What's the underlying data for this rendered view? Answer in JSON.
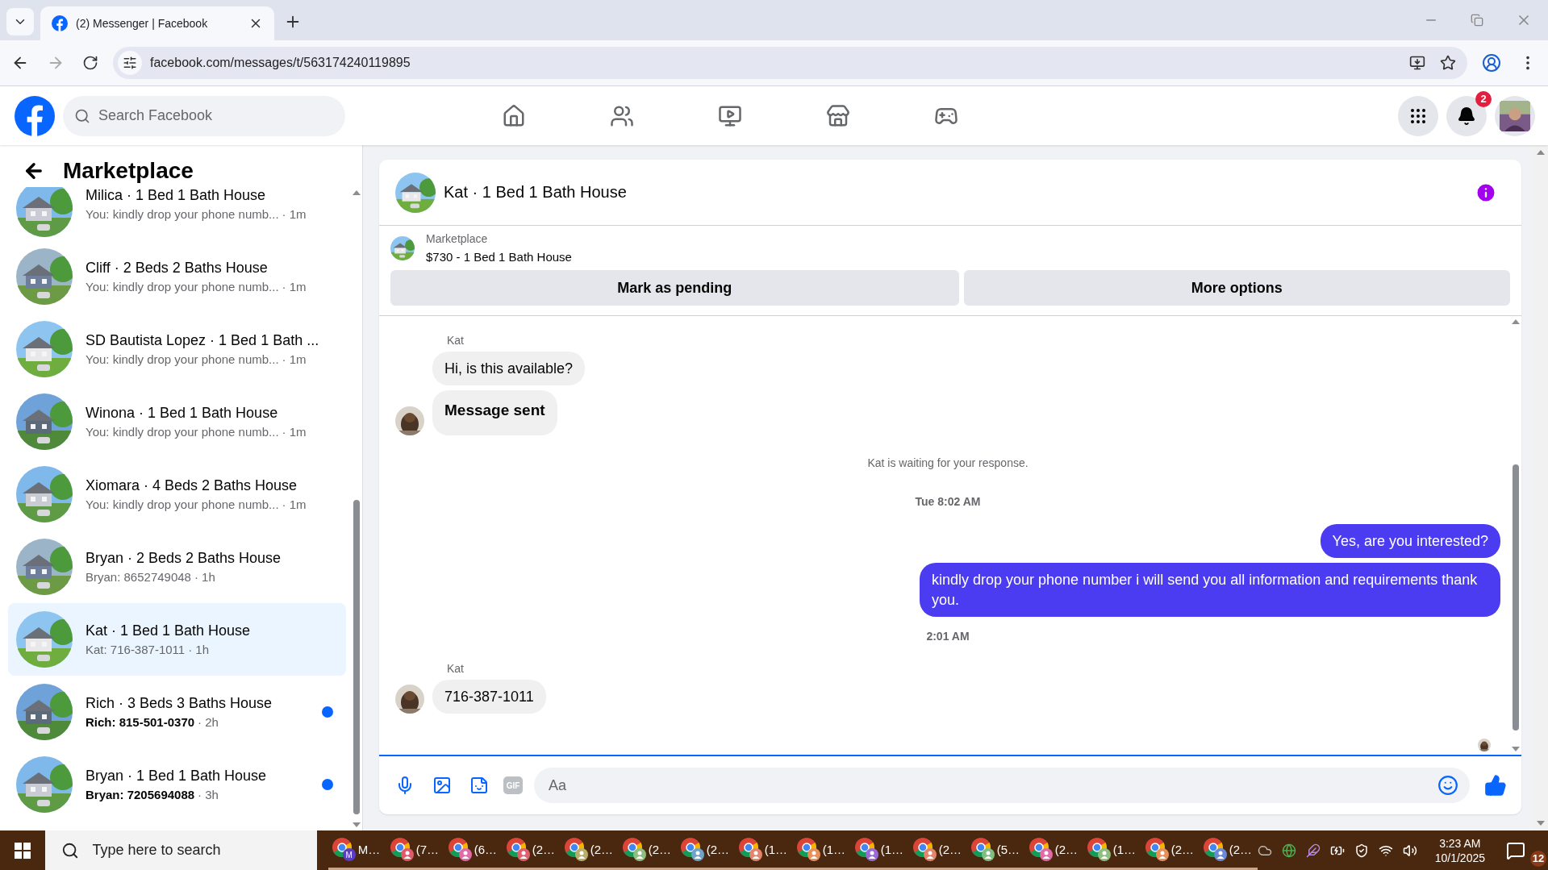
{
  "browser": {
    "tab_title": "(2) Messenger | Facebook",
    "address": "facebook.com/messages/t/563174240119895"
  },
  "header": {
    "search_placeholder": "Search Facebook",
    "notification_count": "2"
  },
  "sidebar": {
    "title": "Marketplace",
    "conversations": [
      {
        "title": "Milica · 1 Bed 1 Bath House",
        "preview": "You: kindly drop your phone numb...",
        "time": "· 1m",
        "selected": false,
        "unread": false
      },
      {
        "title": "Cliff · 2 Beds 2 Baths House",
        "preview": "You: kindly drop your phone numb...",
        "time": "· 1m",
        "selected": false,
        "unread": false
      },
      {
        "title": "SD Bautista Lopez · 1 Bed 1 Bath ...",
        "preview": "You: kindly drop your phone numb...",
        "time": "· 1m",
        "selected": false,
        "unread": false
      },
      {
        "title": "Winona · 1 Bed 1 Bath House",
        "preview": "You: kindly drop your phone numb...",
        "time": "· 1m",
        "selected": false,
        "unread": false
      },
      {
        "title": "Xiomara · 4 Beds 2 Baths House",
        "preview": "You: kindly drop your phone numb...",
        "time": "· 1m",
        "selected": false,
        "unread": false
      },
      {
        "title": "Bryan · 2 Beds 2 Baths House",
        "preview": "Bryan: 8652749048",
        "time": "· 1h",
        "selected": false,
        "unread": false
      },
      {
        "title": "Kat · 1 Bed 1 Bath House",
        "preview": "Kat: 716-387-1011",
        "time": "· 1h",
        "selected": true,
        "unread": false
      },
      {
        "title": "Rich · 3 Beds 3 Baths House",
        "preview": "Rich: 815-501-0370",
        "time": "· 2h",
        "selected": false,
        "unread": true
      },
      {
        "title": "Bryan · 1 Bed 1 Bath House",
        "preview": "Bryan: 7205694088",
        "time": "· 3h",
        "selected": false,
        "unread": true
      }
    ]
  },
  "thread": {
    "title": "Kat · 1 Bed 1 Bath House",
    "listing_label": "Marketplace",
    "listing_detail": "$730 - 1 Bed 1 Bath House",
    "actions": [
      "Mark as pending",
      "More options"
    ],
    "messages": [
      {
        "kind": "sender",
        "text": "Kat"
      },
      {
        "kind": "in",
        "text": "Hi, is this available?",
        "avatar": false,
        "emphasis": false
      },
      {
        "kind": "in",
        "text": "Message sent",
        "avatar": true,
        "emphasis": true
      },
      {
        "kind": "notice",
        "text": "Kat is waiting for your response."
      },
      {
        "kind": "time",
        "text": "Tue 8:02 AM"
      },
      {
        "kind": "out",
        "text": "Yes, are you interested?"
      },
      {
        "kind": "out",
        "text": "kindly drop your phone number i will send you all information and requirements thank you."
      },
      {
        "kind": "time",
        "text": "2:01 AM"
      },
      {
        "kind": "sender",
        "text": "Kat"
      },
      {
        "kind": "in",
        "text": "716-387-1011",
        "avatar": true,
        "emphasis": false
      }
    ],
    "composer": {
      "gif": "GIF",
      "placeholder": "Aa"
    }
  },
  "taskbar": {
    "search_placeholder": "Type here to search",
    "apps": [
      {
        "label": "M…",
        "color": "#5b3cc4",
        "badge": "M"
      },
      {
        "label": "(7…",
        "color": "#e05a6a"
      },
      {
        "label": "(6…",
        "color": "#e26aa8"
      },
      {
        "label": "(2…",
        "color": "#e0606e"
      },
      {
        "label": "(2…",
        "color": "#b8b06a"
      },
      {
        "label": "(2…",
        "color": "#8fbf7f"
      },
      {
        "label": "(2…",
        "color": "#6fa3c8"
      },
      {
        "label": "(1…",
        "color": "#e2856a"
      },
      {
        "label": "(1…",
        "color": "#e8905a"
      },
      {
        "label": "(1…",
        "color": "#9a6ad8"
      },
      {
        "label": "(2…",
        "color": "#e2856a"
      },
      {
        "label": "(5…",
        "color": "#7fbf7f"
      },
      {
        "label": "(2…",
        "color": "#e26aa8"
      },
      {
        "label": "(1…",
        "color": "#8fbf7f"
      },
      {
        "label": "(2…",
        "color": "#e8905a"
      },
      {
        "label": "(2…",
        "color": "#6a8ad8"
      }
    ],
    "time": "3:23 AM",
    "date": "10/1/2025",
    "notification_count": "12"
  }
}
